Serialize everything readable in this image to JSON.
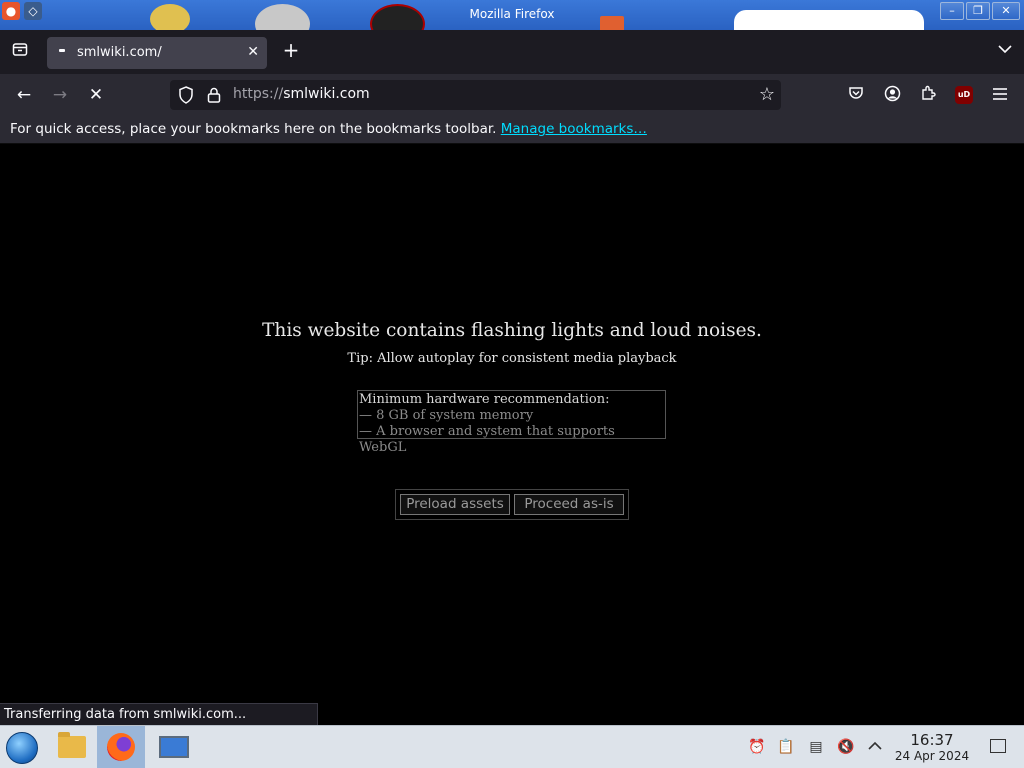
{
  "window": {
    "title": "Mozilla Firefox",
    "controls": {
      "minimize": "–",
      "maximize": "❐",
      "close": "✕"
    }
  },
  "tabs": [
    {
      "label": "smlwiki.com/",
      "close": "✕"
    }
  ],
  "tabstrip": {
    "new_tab": "+",
    "list_all": "⌄"
  },
  "navbar": {
    "back": "←",
    "forward": "→",
    "stop": "✕",
    "url_scheme": "https://",
    "url_host": "smlwiki.com",
    "bookmark_star": "☆"
  },
  "toolbar_icons": [
    "pocket-icon",
    "account-icon",
    "extensions-icon",
    "ublock-icon",
    "menu-icon"
  ],
  "extensions": {
    "ublock_label": "uD"
  },
  "bookmarks_bar": {
    "message": "For quick access, place your bookmarks here on the bookmarks toolbar.",
    "link": "Manage bookmarks…"
  },
  "page": {
    "warning": "This website contains flashing lights and loud noises.",
    "tip": "Tip: Allow autoplay for consistent media playback",
    "hardware": {
      "title": "Minimum hardware recommendation:",
      "lines": [
        "— 8 GB of system memory",
        "— A browser and system that supports WebGL"
      ]
    },
    "buttons": {
      "preload": "Preload assets",
      "proceed": "Proceed as-is"
    }
  },
  "status_bar": {
    "text": "Transferring data from smlwiki.com..."
  },
  "taskbar": {
    "clock_time": "16:37",
    "clock_date": "24 Apr 2024"
  },
  "colors": {
    "accent_link": "#00ddff",
    "chrome_dark": "#1c1b22",
    "chrome_mid": "#2b2a33",
    "taskbar": "#dde3ea"
  }
}
